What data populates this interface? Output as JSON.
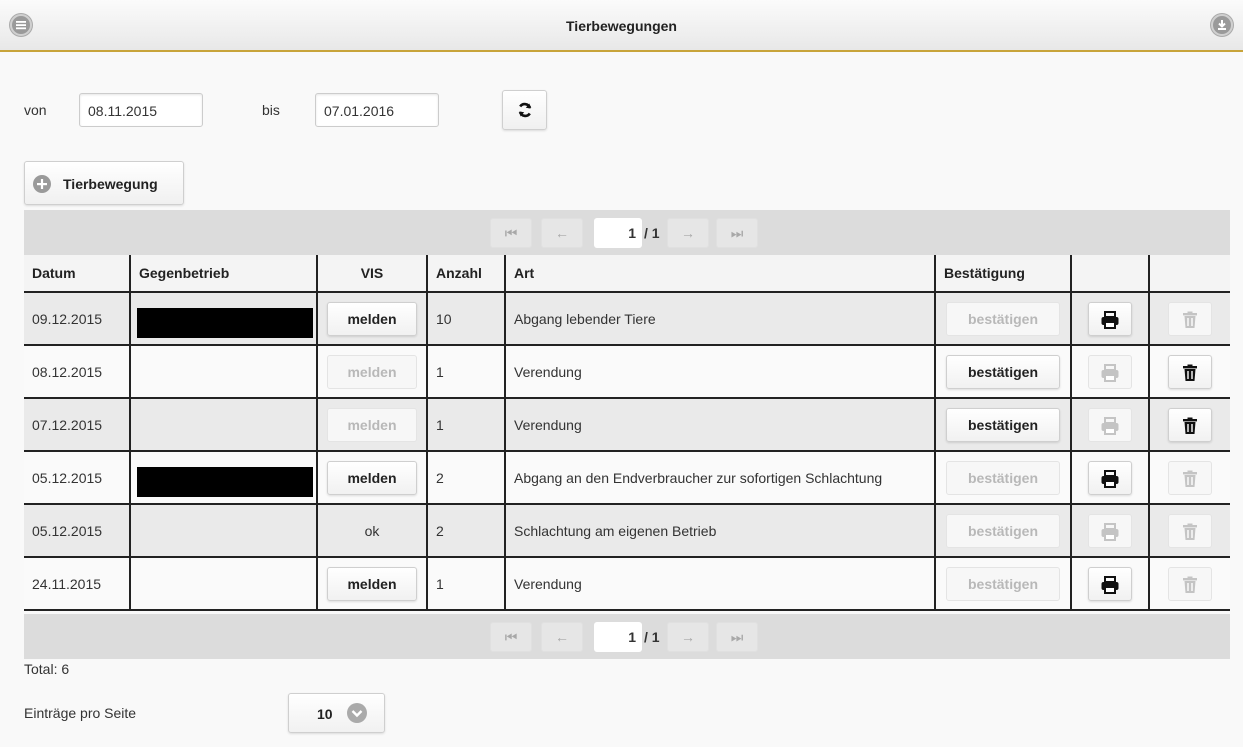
{
  "header": {
    "title": "Tierbewegungen",
    "menu_icon": "menu-icon",
    "download_icon": "download-icon"
  },
  "filter": {
    "from_label": "von",
    "from_value": "08.11.2015",
    "to_label": "bis",
    "to_value": "07.01.2016",
    "refresh_icon": "refresh-icon"
  },
  "add_button": {
    "label": "Tierbewegung",
    "icon": "plus-circle-icon"
  },
  "pager": {
    "first_icon": "first-page-icon",
    "prev_icon": "prev-page-icon",
    "next_icon": "next-page-icon",
    "last_icon": "last-page-icon",
    "page": "1",
    "total": "/ 1"
  },
  "table": {
    "headers": {
      "datum": "Datum",
      "gegenbetrieb": "Gegenbetrieb",
      "vis": "VIS",
      "anzahl": "Anzahl",
      "art": "Art",
      "bestaetigung": "Bestätigung"
    },
    "rows": [
      {
        "datum": "09.12.2015",
        "redacted": true,
        "vis": "melden",
        "vis_type": "button",
        "anzahl": "10",
        "art": "Abgang lebender Tiere",
        "confirm": "bestätigen",
        "confirm_enabled": false,
        "print_enabled": true,
        "delete_enabled": false
      },
      {
        "datum": "08.12.2015",
        "redacted": false,
        "vis": "melden",
        "vis_type": "disabled",
        "anzahl": "1",
        "art": "Verendung",
        "confirm": "bestätigen",
        "confirm_enabled": true,
        "print_enabled": false,
        "delete_enabled": true
      },
      {
        "datum": "07.12.2015",
        "redacted": false,
        "vis": "melden",
        "vis_type": "disabled",
        "anzahl": "1",
        "art": "Verendung",
        "confirm": "bestätigen",
        "confirm_enabled": true,
        "print_enabled": false,
        "delete_enabled": true
      },
      {
        "datum": "05.12.2015",
        "redacted": true,
        "vis": "melden",
        "vis_type": "button",
        "anzahl": "2",
        "art": "Abgang an den Endverbraucher zur sofortigen Schlachtung",
        "confirm": "bestätigen",
        "confirm_enabled": false,
        "print_enabled": true,
        "delete_enabled": false
      },
      {
        "datum": "05.12.2015",
        "redacted": false,
        "vis": "ok",
        "vis_type": "text",
        "anzahl": "2",
        "art": "Schlachtung am eigenen Betrieb",
        "confirm": "bestätigen",
        "confirm_enabled": false,
        "print_enabled": false,
        "delete_enabled": false
      },
      {
        "datum": "24.11.2015",
        "redacted": false,
        "vis": "melden",
        "vis_type": "button",
        "anzahl": "1",
        "art": "Verendung",
        "confirm": "bestätigen",
        "confirm_enabled": false,
        "print_enabled": true,
        "delete_enabled": false
      }
    ]
  },
  "footer": {
    "total": "Total: 6",
    "per_page_label": "Einträge pro Seite",
    "per_page_value": "10"
  },
  "colors": {
    "accent_line": "#c8a43a",
    "enabled_icon": "#111111",
    "disabled_icon": "#c4c4c4"
  }
}
